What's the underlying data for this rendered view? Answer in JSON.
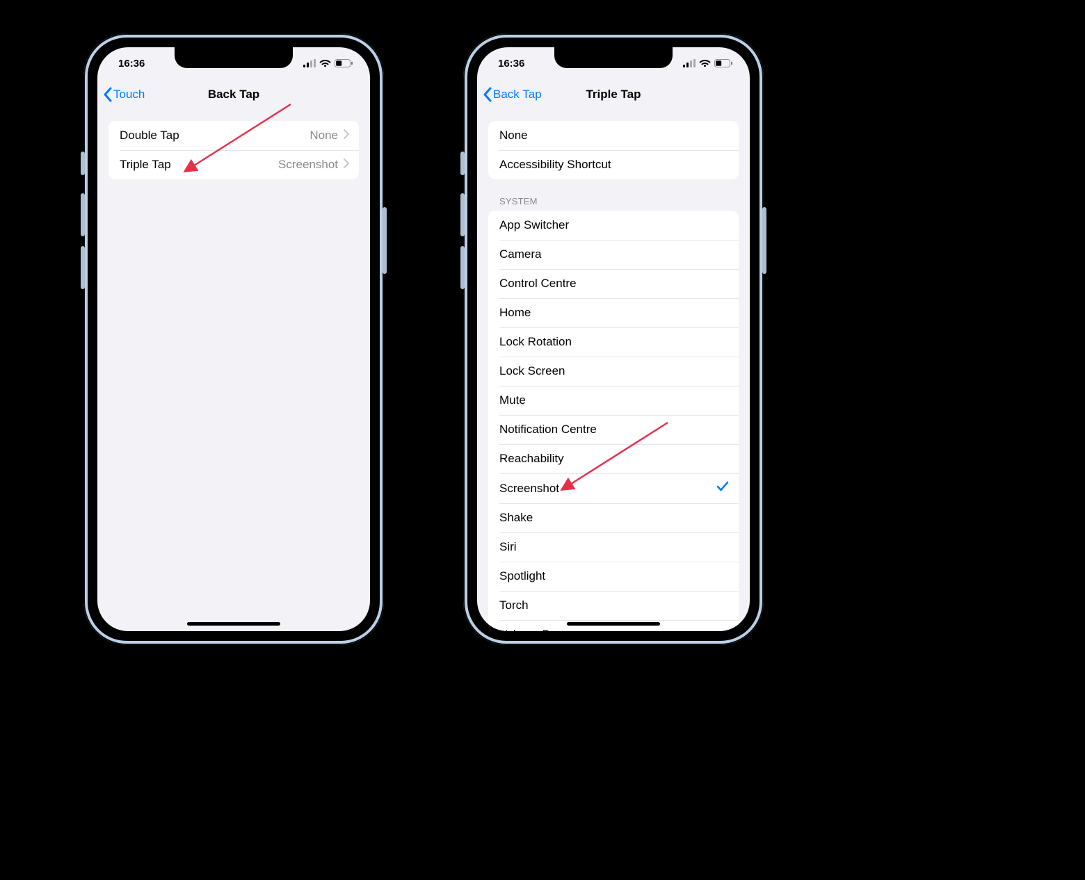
{
  "status": {
    "time": "16:36"
  },
  "accent": "#007aff",
  "phone_left": {
    "nav": {
      "back_label": "Touch",
      "title": "Back Tap"
    },
    "rows": [
      {
        "label": "Double Tap",
        "value": "None"
      },
      {
        "label": "Triple Tap",
        "value": "Screenshot"
      }
    ]
  },
  "phone_right": {
    "nav": {
      "back_label": "Back Tap",
      "title": "Triple Tap"
    },
    "top_group": [
      {
        "label": "None",
        "checked": false
      },
      {
        "label": "Accessibility Shortcut",
        "checked": false
      }
    ],
    "section_header": "SYSTEM",
    "system_group": [
      {
        "label": "App Switcher",
        "checked": false
      },
      {
        "label": "Camera",
        "checked": false
      },
      {
        "label": "Control Centre",
        "checked": false
      },
      {
        "label": "Home",
        "checked": false
      },
      {
        "label": "Lock Rotation",
        "checked": false
      },
      {
        "label": "Lock Screen",
        "checked": false
      },
      {
        "label": "Mute",
        "checked": false
      },
      {
        "label": "Notification Centre",
        "checked": false
      },
      {
        "label": "Reachability",
        "checked": false
      },
      {
        "label": "Screenshot",
        "checked": true
      },
      {
        "label": "Shake",
        "checked": false
      },
      {
        "label": "Siri",
        "checked": false
      },
      {
        "label": "Spotlight",
        "checked": false
      },
      {
        "label": "Torch",
        "checked": false
      },
      {
        "label": "Volume Down",
        "checked": false
      }
    ]
  }
}
